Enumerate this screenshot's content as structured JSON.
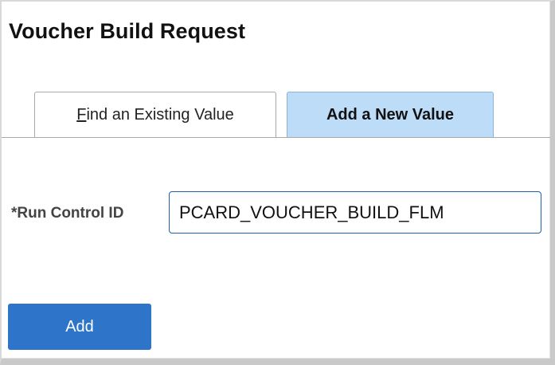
{
  "page": {
    "title": "Voucher Build Request"
  },
  "tabs": {
    "find_accesskey": "F",
    "find_rest": "ind an Existing Value",
    "add": "Add a New Value",
    "active": "add"
  },
  "form": {
    "run_control_label": "*Run Control ID",
    "run_control_value": "PCARD_VOUCHER_BUILD_FLM"
  },
  "actions": {
    "add_label": "Add"
  },
  "colors": {
    "active_tab": "#bcdcf8",
    "primary_button": "#2e74c9",
    "input_border": "#1d5faa"
  }
}
